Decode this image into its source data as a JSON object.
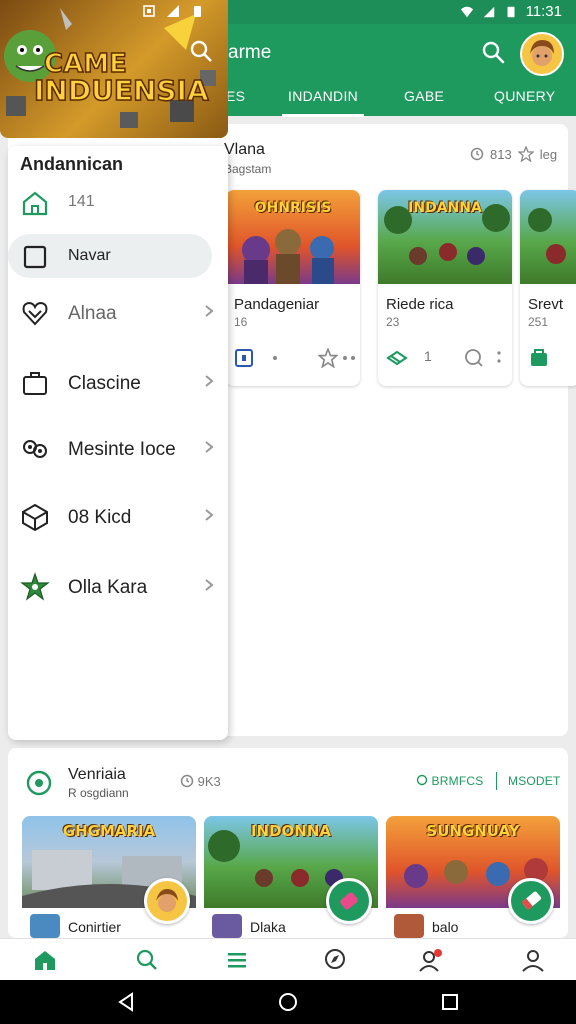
{
  "status_bar": {
    "time": "11:31"
  },
  "app_bar": {
    "title": "arme",
    "tabs": [
      "ES",
      "INDANDIN",
      "GABE",
      "QUNERY"
    ]
  },
  "logo": {
    "text_line1": "CAME",
    "text_line2": "INDUENSIA"
  },
  "section": {
    "title": "Vlana",
    "subtitle": "Bagstam",
    "meta": "813"
  },
  "games": [
    {
      "art_title": "OHNRISIS",
      "name": "Pandageniar",
      "num": "16",
      "art_color": "#e05a2a"
    },
    {
      "art_title": "INDANNA",
      "name": "Riede rica",
      "num": "23",
      "art_color": "#3a9a4a",
      "action_num": "1"
    },
    {
      "art_title": "",
      "name": "Srevt",
      "num": "251",
      "art_color": "#4a8a3a"
    }
  ],
  "lower_section": {
    "title": "Venriaia",
    "subtitle": "R osgdiann",
    "count": "9K3",
    "button1": "BRMFCS",
    "button2": "MSODET"
  },
  "tiles": [
    {
      "art_title": "GHGMARIA",
      "name": "Conirtier"
    },
    {
      "art_title": "INDONNA",
      "name": "Dlaka"
    },
    {
      "art_title": "SUNGNUAY",
      "name": "balo"
    }
  ],
  "drawer": {
    "title": "Andannican",
    "items": [
      {
        "label": "141",
        "icon": "home-icon"
      },
      {
        "label": "Navar",
        "icon": "square-icon"
      },
      {
        "label": "Alnaa",
        "icon": "heart-icon"
      },
      {
        "label": "Clascine",
        "icon": "briefcase-icon"
      },
      {
        "label": "Mesinte Ioce",
        "icon": "rings-icon"
      },
      {
        "label": "08 Kicd",
        "icon": "box-icon"
      },
      {
        "label": "Olla Kara",
        "icon": "star-badge-icon"
      }
    ]
  },
  "colors": {
    "primary": "#1f9a5f",
    "status_bar": "#1d8e58"
  }
}
